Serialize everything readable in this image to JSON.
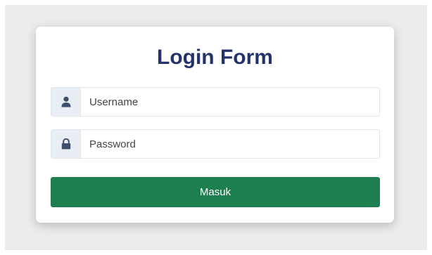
{
  "form": {
    "title": "Login Form",
    "username": {
      "icon": "user-icon",
      "placeholder": "Username",
      "value": ""
    },
    "password": {
      "icon": "lock-icon",
      "placeholder": "Password",
      "value": ""
    },
    "submit_label": "Masuk"
  },
  "colors": {
    "page_background": "#ececec",
    "card_background": "#ffffff",
    "title": "#24346b",
    "addon_background": "#e9eef5",
    "icon": "#3d4f6b",
    "button": "#1d7f4f",
    "button_text": "#ffffff"
  }
}
